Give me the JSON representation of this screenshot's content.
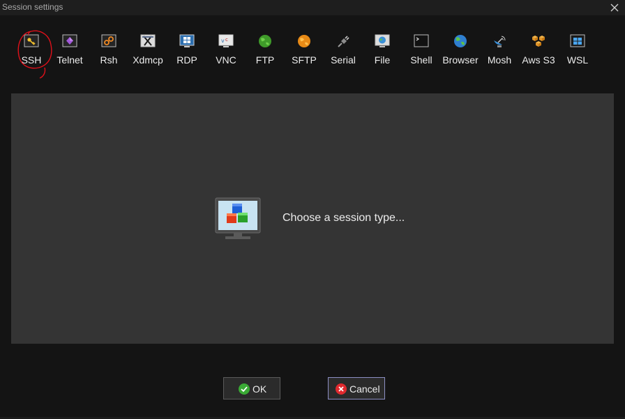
{
  "window": {
    "title": "Session settings"
  },
  "toolbar": {
    "items": [
      {
        "label": "SSH",
        "icon": "key-icon"
      },
      {
        "label": "Telnet",
        "icon": "telnet-icon"
      },
      {
        "label": "Rsh",
        "icon": "rsh-icon"
      },
      {
        "label": "Xdmcp",
        "icon": "x-icon"
      },
      {
        "label": "RDP",
        "icon": "windows-icon"
      },
      {
        "label": "VNC",
        "icon": "vnc-icon"
      },
      {
        "label": "FTP",
        "icon": "ftp-globe-icon"
      },
      {
        "label": "SFTP",
        "icon": "sftp-icon"
      },
      {
        "label": "Serial",
        "icon": "serial-plug-icon"
      },
      {
        "label": "File",
        "icon": "file-icon"
      },
      {
        "label": "Shell",
        "icon": "terminal-icon"
      },
      {
        "label": "Browser",
        "icon": "globe-icon"
      },
      {
        "label": "Mosh",
        "icon": "satellite-icon"
      },
      {
        "label": "Aws S3",
        "icon": "aws-s3-icon"
      },
      {
        "label": "WSL",
        "icon": "wsl-windows-icon"
      }
    ]
  },
  "main": {
    "prompt": "Choose a session type..."
  },
  "buttons": {
    "ok_label": "OK",
    "cancel_label": "Cancel"
  },
  "colors": {
    "background": "#141414",
    "panel": "#343434",
    "annotation": "#e0101a",
    "ok_green": "#3aaa35",
    "cancel_red": "#e0292e",
    "cancel_border": "#8c8fc4"
  }
}
